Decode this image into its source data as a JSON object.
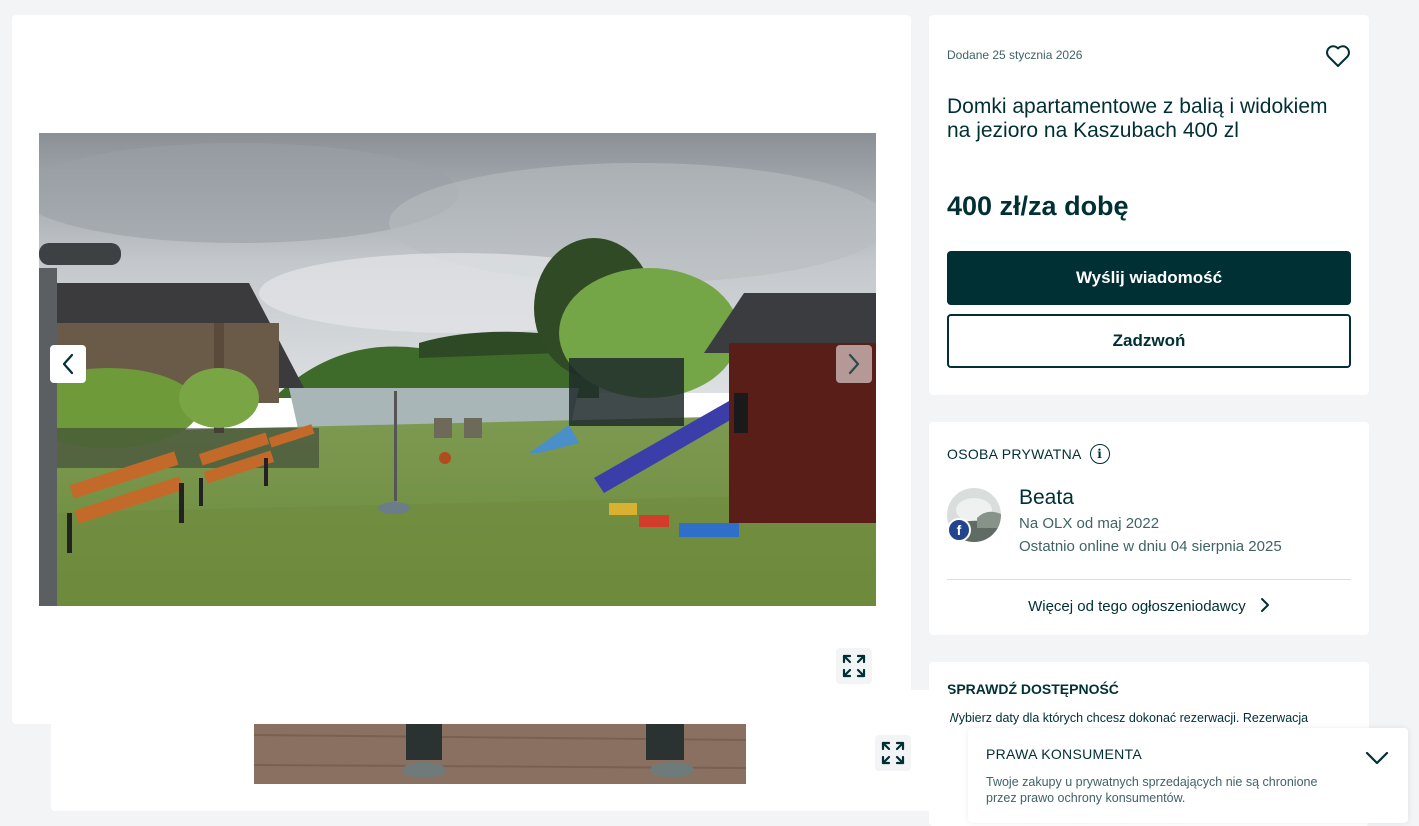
{
  "gallery": {
    "prev_icon": "chevron-left-icon",
    "next_icon": "chevron-right-icon",
    "fullscreen_icon": "expand-icon"
  },
  "ad": {
    "date": "Dodane 25 stycznia 2026",
    "title": "Domki apartamentowe z balią i widokiem na jezioro na Kaszubach 400 zl",
    "price": "400 zł/za dobę",
    "message_button": "Wyślij wiadomość",
    "call_button": "Zadzwoń",
    "favorite_icon": "heart-icon"
  },
  "seller": {
    "type_label": "OSOBA PRYWATNA",
    "info_icon_glyph": "i",
    "name": "Beata",
    "since": "Na OLX od maj 2022",
    "last_online": "Ostatnio online w dniu 04 sierpnia 2025",
    "more_link": "Więcej od tego ogłoszeniodawcy",
    "facebook_badge": "f"
  },
  "availability": {
    "title": "SPRAWDŹ DOSTĘPNOŚĆ",
    "text": "Wybierz daty dla których chcesz dokonać rezerwacji. Rezerwacja"
  },
  "consumer_rights": {
    "title": "PRAWA KONSUMENTA",
    "text": "Twoje zakupy u prywatnych sprzedających nie są chronione przez prawo ochrony konsumentów."
  },
  "colors": {
    "primary": "#002f34",
    "background": "#f2f4f5",
    "muted_text": "#406367",
    "facebook": "#23438f"
  }
}
